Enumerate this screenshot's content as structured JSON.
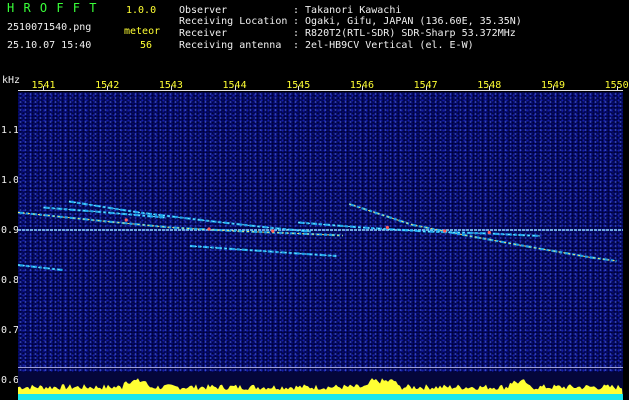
{
  "header": {
    "app_name": "H R O F F T",
    "version": "1.0.0",
    "filename": "2510071540.png",
    "datetime": "25.10.07 15:40",
    "meteor_label": "meteor",
    "meteor_count": "56",
    "info": [
      {
        "key": "Observer",
        "value": ": Takanori Kawachi"
      },
      {
        "key": "Receiving Location",
        "value": ": Ogaki, Gifu, JAPAN (136.60E, 35.35N)"
      },
      {
        "key": "Receiver",
        "value": ": R820T2(RTL-SDR) SDR-Sharp 53.372MHz"
      },
      {
        "key": "Receiving antenna",
        "value": ": 2el-HB9CV Vertical (el. E-W)"
      }
    ]
  },
  "chart_data": {
    "type": "heatmap",
    "ylabel": "kHz",
    "x_ticks": [
      "1541",
      "1542",
      "1543",
      "1544",
      "1545",
      "1546",
      "1547",
      "1548",
      "1549",
      "1550"
    ],
    "y_ticks": [
      "1.1",
      "1.0",
      "0.9",
      "0.8",
      "0.7",
      "0.6"
    ],
    "ylim": [
      0.6,
      1.15
    ],
    "xlim": [
      1540.6,
      1550.1
    ],
    "carrier_khz": 0.9,
    "traces": [
      {
        "x": [
          1540.6,
          1542.0,
          1543.0,
          1544.0,
          1545.0,
          1545.7
        ],
        "y": [
          0.935,
          0.917,
          0.905,
          0.898,
          0.893,
          0.889
        ]
      },
      {
        "x": [
          1541.0,
          1542.0,
          1542.9
        ],
        "y": [
          0.945,
          0.935,
          0.925
        ]
      },
      {
        "x": [
          1541.4,
          1542.5,
          1543.6,
          1544.6,
          1545.2
        ],
        "y": [
          0.957,
          0.935,
          0.918,
          0.904,
          0.897
        ]
      },
      {
        "x": [
          1545.8,
          1546.8,
          1547.6,
          1548.6,
          1549.6,
          1550.0
        ],
        "y": [
          0.952,
          0.91,
          0.89,
          0.867,
          0.845,
          0.838
        ]
      },
      {
        "x": [
          1540.6,
          1541.3
        ],
        "y": [
          0.83,
          0.82
        ]
      },
      {
        "x": [
          1545.0,
          1546.0,
          1547.0,
          1548.0,
          1548.8
        ],
        "y": [
          0.915,
          0.905,
          0.897,
          0.893,
          0.888
        ]
      },
      {
        "x": [
          1543.3,
          1544.2,
          1545.0,
          1545.6
        ],
        "y": [
          0.868,
          0.86,
          0.853,
          0.848
        ]
      }
    ]
  },
  "colors": {
    "background": "#000000",
    "plot_bg": "#050a70",
    "label_green": "#39ff39",
    "label_yellow": "#ffff33",
    "signal_yellow": "#ffff33",
    "signal_cyan": "#00e5ff"
  }
}
